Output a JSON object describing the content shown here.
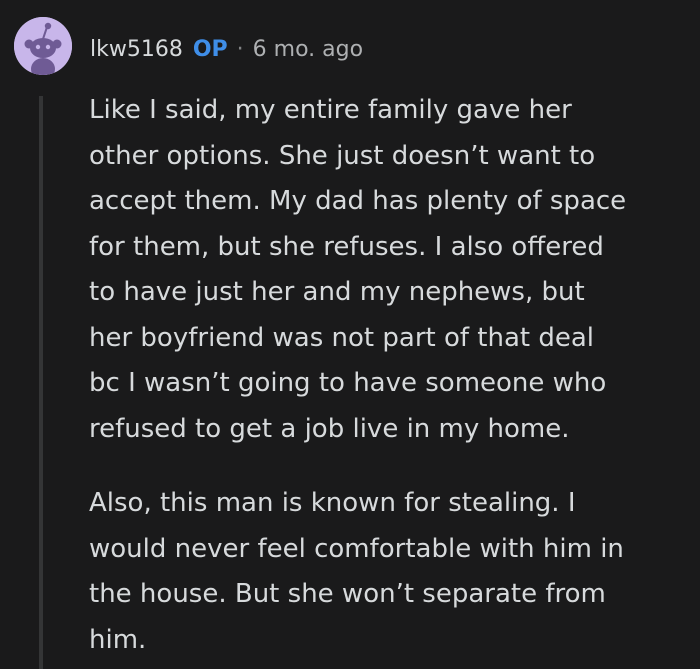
{
  "comment": {
    "avatar_icon": "reddit-snoo-avatar",
    "avatar_color": "#c8b6ea",
    "username": "lkw5168",
    "op_badge": "OP",
    "separator": "·",
    "timestamp": "6 mo. ago",
    "paragraphs": [
      {
        "lines": [
          "Like I said, my entire family gave her",
          "other options. She just doesn’t want to",
          "accept them. My dad has plenty of space",
          "for them, but she refuses. I also offered",
          "to have just her and my nephews, but",
          "her boyfriend was not part of that deal",
          "bc I wasn’t going to have someone who",
          "refused to get a job live in my home."
        ]
      },
      {
        "lines": [
          "Also, this man is known for stealing. I",
          "would never feel comfortable with him in",
          "the house. But she won’t separate from",
          "him."
        ]
      }
    ]
  },
  "colors": {
    "background": "#1a1a1b",
    "text": "#d7dadc",
    "op_badge": "#3f8ee8",
    "muted": "#818384",
    "thread_line": "#343536"
  }
}
